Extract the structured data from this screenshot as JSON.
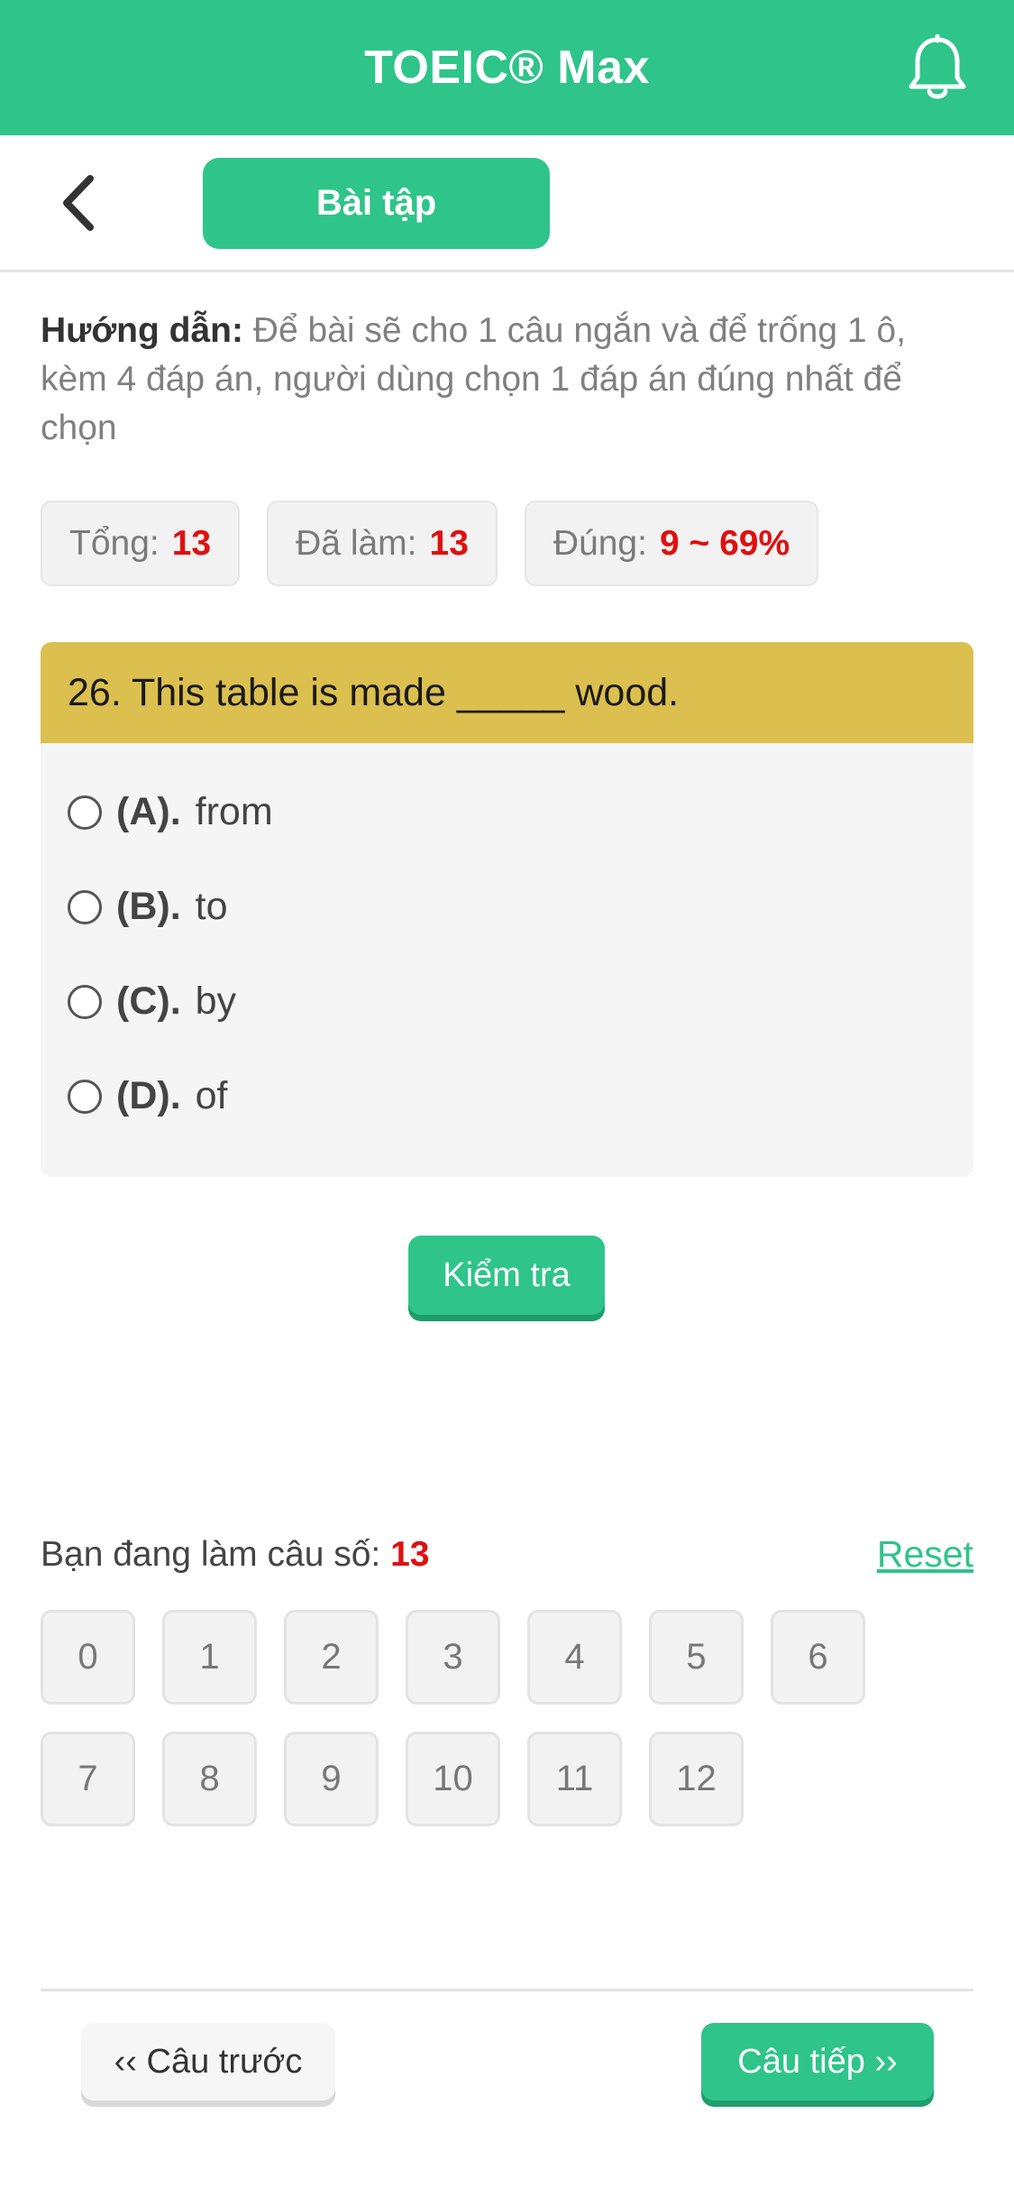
{
  "header": {
    "title": "TOEIC® Max",
    "bell_icon": "bell-icon",
    "bg_color": "#2ec48a"
  },
  "subheader": {
    "back_icon": "chevron-left-icon",
    "tab_label": "Bài tập"
  },
  "instruction": {
    "label": "Hướng dẫn:",
    "text": "Để bài sẽ cho 1 câu ngắn và để trống 1 ô, kèm 4 đáp án, người dùng chọn 1 đáp án đúng nhất để chọn"
  },
  "stats": {
    "total_label": "Tổng:",
    "total_value": "13",
    "done_label": "Đã làm:",
    "done_value": "13",
    "correct_label": "Đúng:",
    "correct_value": "9 ~ 69%"
  },
  "question": {
    "text": "26. This table is made _____ wood.",
    "options": [
      {
        "letter": "(A).",
        "text": "from"
      },
      {
        "letter": "(B).",
        "text": "to"
      },
      {
        "letter": "(C).",
        "text": "by"
      },
      {
        "letter": "(D).",
        "text": "of"
      }
    ]
  },
  "check_label": "Kiểm tra",
  "progress": {
    "label": "Bạn đang làm câu số:",
    "current": "13",
    "reset_label": "Reset"
  },
  "question_numbers": [
    "0",
    "1",
    "2",
    "3",
    "4",
    "5",
    "6",
    "7",
    "8",
    "9",
    "10",
    "11",
    "12"
  ],
  "nav": {
    "prev_label": "‹‹ Câu trước",
    "next_label": "Câu tiếp ››"
  },
  "colors": {
    "accent": "#2ec48a",
    "question_bar": "#dbbf4f",
    "highlight_number": "#e01010"
  }
}
